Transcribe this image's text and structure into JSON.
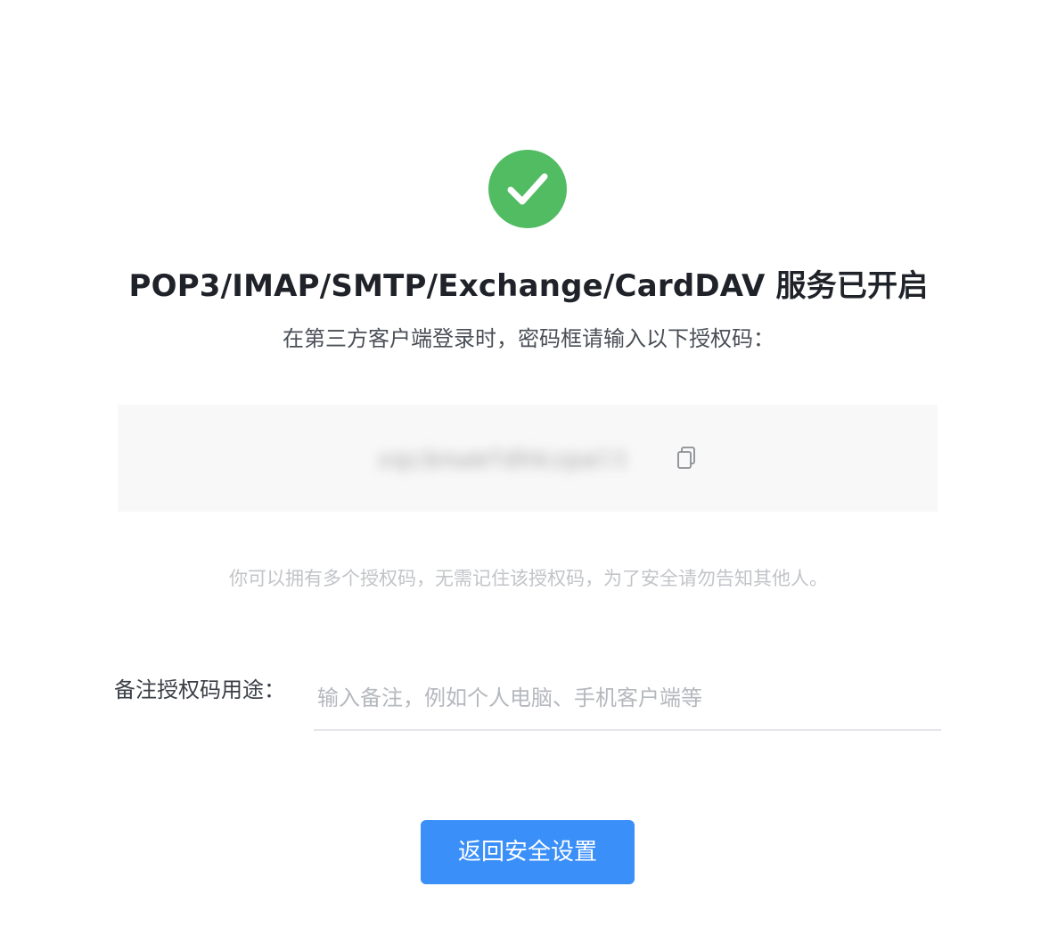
{
  "status_icon": "check-circle-icon",
  "colors": {
    "success": "#52bc63",
    "primary": "#3a8ff9",
    "code_background": "#f8f8f8"
  },
  "title": "POP3/IMAP/SMTP/Exchange/CardDAV 服务已开启",
  "subtitle": "在第三方客户端登录时，密码框请输入以下授权码：",
  "auth_code": {
    "value": "xqcbnwmfdhkzpalt",
    "copy_icon": "copy-icon"
  },
  "hint": "你可以拥有多个授权码，无需记住该授权码，为了安全请勿告知其他人。",
  "note": {
    "label": "备注授权码用途：",
    "placeholder": "输入备注，例如个人电脑、手机客户端等",
    "value": ""
  },
  "back_button_label": "返回安全设置"
}
